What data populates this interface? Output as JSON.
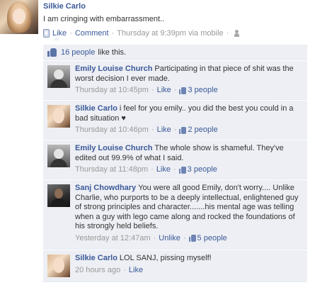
{
  "post": {
    "author": "Silkie Carlo",
    "text": "I am cringing with embarrassment..",
    "like_label": "Like",
    "comment_label": "Comment",
    "timestamp": "Thursday at 9:39pm via mobile",
    "separator": "·"
  },
  "likes": {
    "count_link": "16 people",
    "tail": "like this."
  },
  "comments": [
    {
      "author": "Emily Louise Church",
      "text": "Participating in that piece of shit was the worst decision I ever made.",
      "time": "Thursday at 10:45pm",
      "like_label": "Like",
      "likes": "3 people"
    },
    {
      "author": "Silkie Carlo",
      "text": "i feel for you emily.. you did the best you could in a bad situation ♥",
      "time": "Thursday at 10:46pm",
      "like_label": "Like",
      "likes": "2 people"
    },
    {
      "author": "Emily Louise Church",
      "text": "The whole show is shameful. They've edited out 99.9% of what I said.",
      "time": "Thursday at 11:48pm",
      "like_label": "Like",
      "likes": "3 people"
    },
    {
      "author": "Sanj Chowdhary",
      "text": "You were all good Emily, don't worry.... Unlike Charlie, who purports to be a deeply intellectual, enlightened guy of strong principles and character.......his mental age was telling when a guy with lego came along and rocked the foundations of his strongly held beliefs.",
      "time": "Yesterday at 12:47am",
      "like_label": "Unlike",
      "likes": "5 people"
    },
    {
      "author": "Silkie Carlo",
      "text": "LOL SANJ, pissing myself!",
      "time": "20 hours ago",
      "like_label": "Like",
      "likes": ""
    }
  ]
}
